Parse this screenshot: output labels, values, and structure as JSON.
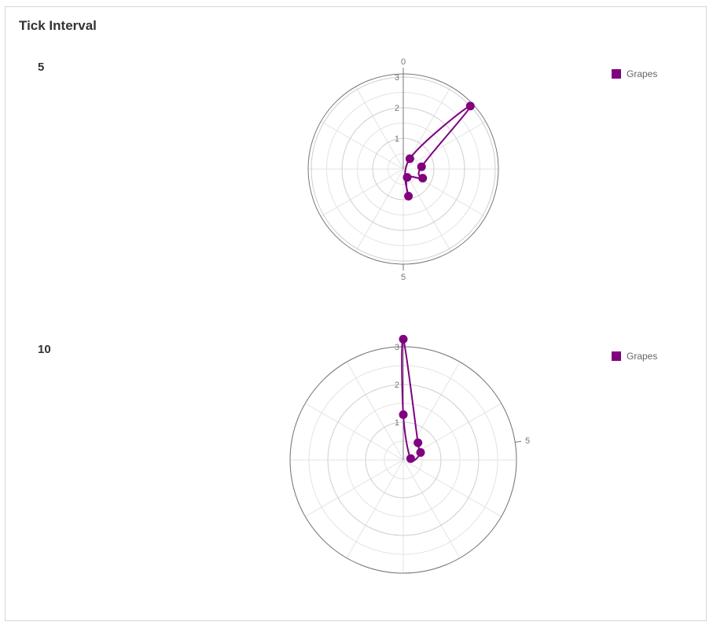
{
  "panel": {
    "title": "Tick Interval"
  },
  "colors": {
    "series": "#800080",
    "grid": "#e3e3e3",
    "ring": "#cfcfcf",
    "outer": "#777777",
    "axis_text": "#777777"
  },
  "chart_data": [
    {
      "type": "polar-line",
      "label": "5",
      "legend": "Grapes",
      "angle_axis": {
        "tick_interval": 5,
        "tick_labels": [
          "0",
          "5"
        ]
      },
      "radius_axis": {
        "ticks": [
          "1",
          "2",
          "3"
        ],
        "max": 3.5
      },
      "series": [
        {
          "name": "Grapes",
          "points": [
            {
              "angle": 0.9,
              "r": 0.4
            },
            {
              "angle": 1.3,
              "r": 3.0
            },
            {
              "angle": 2.3,
              "r": 0.6
            },
            {
              "angle": 3.2,
              "r": 0.7
            },
            {
              "angle": 4.3,
              "r": 0.3
            },
            {
              "angle": 4.7,
              "r": 0.9
            }
          ]
        }
      ]
    },
    {
      "type": "polar-line",
      "label": "10",
      "legend": "Grapes",
      "angle_axis": {
        "tick_interval": 10,
        "tick_labels": [
          "5"
        ]
      },
      "radius_axis": {
        "ticks": [
          "1",
          "2",
          "3"
        ],
        "max": 3.5
      },
      "series": [
        {
          "name": "Grapes",
          "points": [
            {
              "angle": 0.0,
              "r": 1.2
            },
            {
              "angle": 0.0,
              "r": 3.2
            },
            {
              "angle": 2.25,
              "r": 0.6
            },
            {
              "angle": 3.7,
              "r": 0.5
            },
            {
              "angle": 4.4,
              "r": 0.2
            }
          ]
        }
      ]
    }
  ]
}
